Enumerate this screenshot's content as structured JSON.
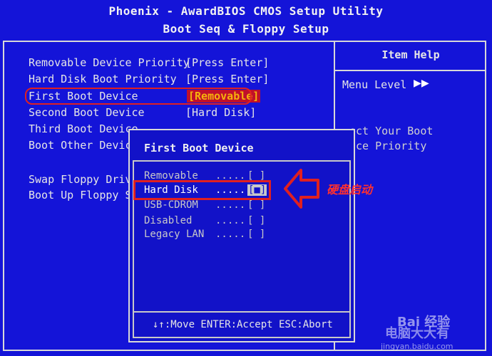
{
  "header": {
    "title": "Phoenix - AwardBIOS CMOS Setup Utility",
    "subtitle": "Boot Seq & Floppy Setup"
  },
  "settings": [
    {
      "label": "Removable Device Priority",
      "value": "[Press Enter]"
    },
    {
      "label": "Hard Disk Boot Priority",
      "value": "[Press Enter]"
    },
    {
      "label": "First Boot Device",
      "value": "[Removable]"
    },
    {
      "label": "Second Boot Device",
      "value": "[Hard Disk]"
    },
    {
      "label": "Third Boot Device",
      "value": ""
    },
    {
      "label": "Boot Other Device",
      "value": ""
    },
    {
      "label": "Swap Floppy Drive",
      "value": ""
    },
    {
      "label": "Boot Up Floppy Se",
      "value": ""
    }
  ],
  "help": {
    "title": "Item Help",
    "menu_level": "Menu Level",
    "menu_level_arrows": "▶▶",
    "line1": "ect Your Boot",
    "line2": "ice Priority"
  },
  "popup": {
    "title": "First Boot Device",
    "options": [
      {
        "label": "Removable",
        "dots": ".....",
        "box": "[ ]"
      },
      {
        "label": "Hard Disk",
        "dots": ".....",
        "box": "[■]"
      },
      {
        "label": "USB-CDROM",
        "dots": ".....",
        "box": "[ ]"
      },
      {
        "label": "Disabled",
        "dots": ".....",
        "box": "[ ]"
      },
      {
        "label": "Legacy LAN",
        "dots": ".....",
        "box": "[ ]"
      }
    ],
    "help": "↓↑:Move ENTER:Accept ESC:Abort"
  },
  "annotation": {
    "text": "硬盘启动"
  },
  "watermark": {
    "brand": "Bai 经验",
    "tag": "电脑大大有",
    "url": "jingyan.baidu.com"
  },
  "colors": {
    "background": "#1414d8",
    "highlight": "#c0102a",
    "highlight_text": "#f6b20c",
    "annotation": "#e02020"
  }
}
